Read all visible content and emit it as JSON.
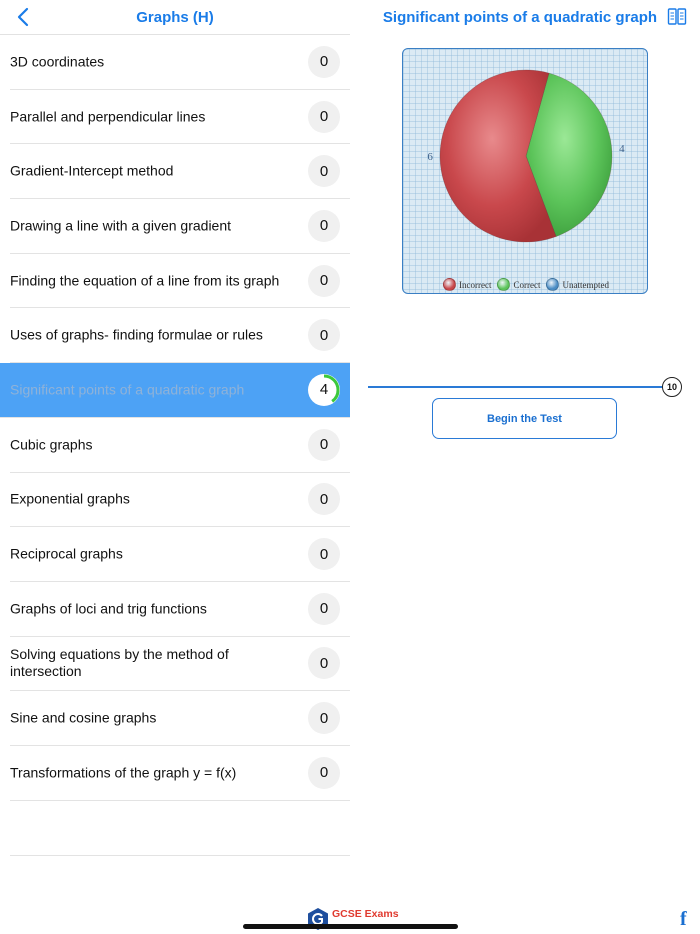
{
  "header": {
    "left_title": "Graphs (H)",
    "right_title": "Significant points of a quadratic graph"
  },
  "topics": [
    {
      "label": "3D coordinates",
      "score": "0",
      "selected": false
    },
    {
      "label": "Parallel and perpendicular lines",
      "score": "0",
      "selected": false
    },
    {
      "label": "Gradient-Intercept method",
      "score": "0",
      "selected": false
    },
    {
      "label": "Drawing a line with a given gradient",
      "score": "0",
      "selected": false
    },
    {
      "label": "Finding the equation of a line from its graph",
      "score": "0",
      "selected": false
    },
    {
      "label": "Uses of graphs- finding formulae or rules",
      "score": "0",
      "selected": false
    },
    {
      "label": "Significant points of a quadratic graph",
      "score": "4",
      "selected": true,
      "progress": 0.4
    },
    {
      "label": "Cubic graphs",
      "score": "0",
      "selected": false
    },
    {
      "label": "Exponential graphs",
      "score": "0",
      "selected": false
    },
    {
      "label": "Reciprocal graphs",
      "score": "0",
      "selected": false
    },
    {
      "label": "Graphs of loci and trig functions",
      "score": "0",
      "selected": false
    },
    {
      "label": "Solving equations by the method of intersection",
      "score": "0",
      "selected": false
    },
    {
      "label": "Sine and cosine graphs",
      "score": "0",
      "selected": false
    },
    {
      "label": "Transformations of the graph y = f(x)",
      "score": "0",
      "selected": false
    }
  ],
  "chart_data": {
    "type": "pie",
    "categories": [
      "Incorrect",
      "Correct",
      "Unattempted"
    ],
    "values": [
      6,
      4,
      0
    ],
    "data_labels": [
      "6",
      "4",
      ""
    ],
    "colors": [
      "#c8464a",
      "#5cc45a",
      "#4a8cc4"
    ],
    "legend": "bottom"
  },
  "slider": {
    "value": "10"
  },
  "begin_button": "Begin the Test",
  "footer": {
    "logo_text": "GCSE Exams",
    "facebook_label": "f"
  }
}
